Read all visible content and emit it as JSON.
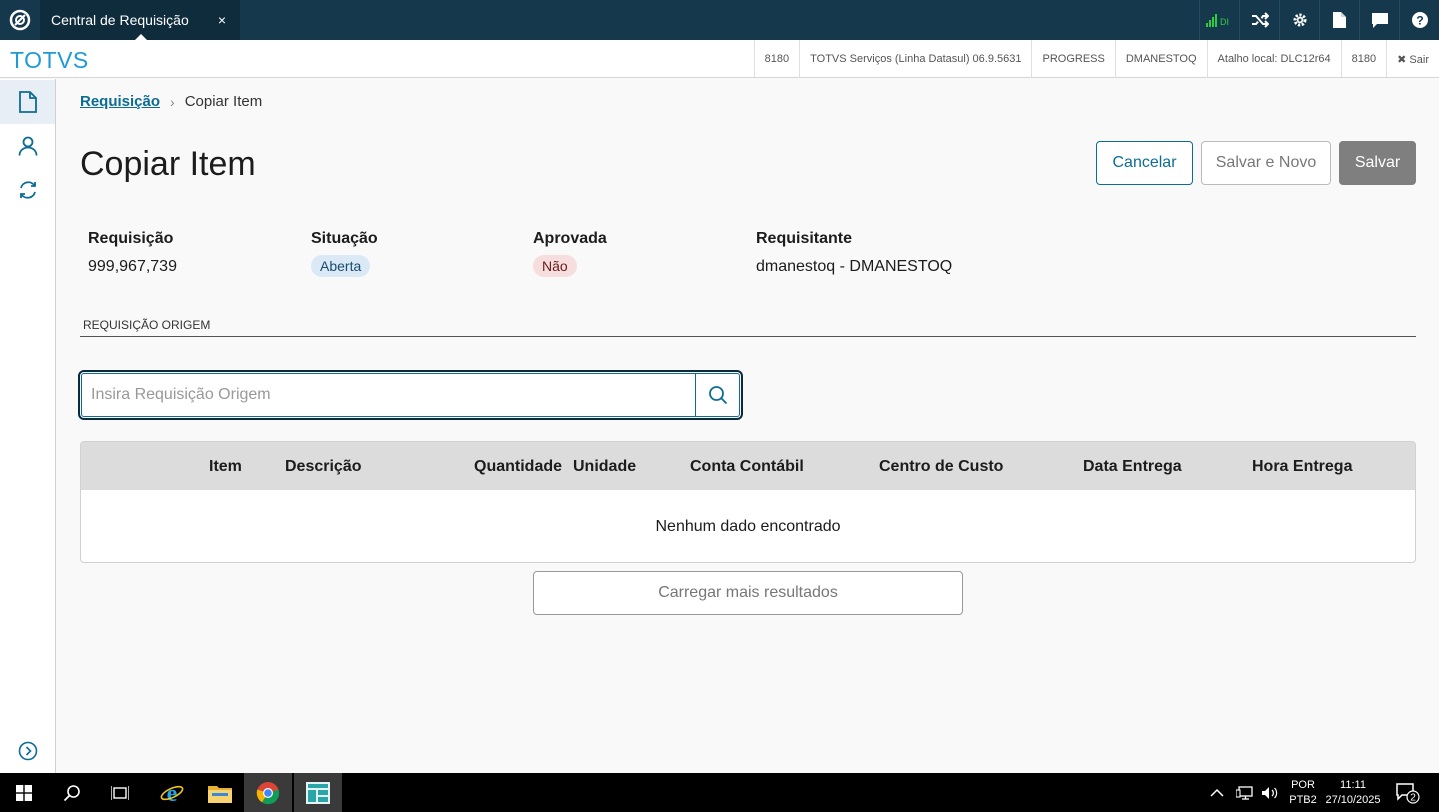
{
  "titlebar": {
    "tab_title": "Central de Requisição",
    "tab_close": "×",
    "signal_label": "DI"
  },
  "infobar": {
    "brand": "TOTVS",
    "items": [
      "8180",
      "TOTVS Serviços (Linha Datasul) 06.9.5631",
      "PROGRESS",
      "DMANESTOQ",
      "Atalho local: DLC12r64",
      "8180"
    ],
    "exit_label": "✖ Sair"
  },
  "breadcrumb": {
    "link": "Requisição",
    "separator": "›",
    "current": "Copiar Item"
  },
  "page": {
    "title": "Copiar Item"
  },
  "actions": {
    "cancel": "Cancelar",
    "save_new": "Salvar e Novo",
    "save": "Salvar"
  },
  "details": {
    "requisicao_label": "Requisição",
    "requisicao_value": "999,967,739",
    "situacao_label": "Situação",
    "situacao_value": "Aberta",
    "aprovada_label": "Aprovada",
    "aprovada_value": "Não",
    "requisitante_label": "Requisitante",
    "requisitante_value": "dmanestoq - DMANESTOQ"
  },
  "section": {
    "title": "REQUISIÇÃO ORIGEM"
  },
  "search": {
    "placeholder": "Insira Requisição Origem",
    "value": ""
  },
  "table": {
    "columns": [
      "Item",
      "Descrição",
      "Quantidade",
      "Unidade",
      "Conta Contábil",
      "Centro de Custo",
      "Data Entrega",
      "Hora Entrega"
    ],
    "empty_message": "Nenhum dado encontrado"
  },
  "load_more": "Carregar mais resultados",
  "taskbar": {
    "lang_top": "POR",
    "lang_bottom": "PTB2",
    "time": "11:11",
    "date": "27/10/2025",
    "notif_count": "2"
  },
  "colors": {
    "topbar": "#16384d",
    "brand": "#1e9bd7",
    "primary": "#0c6c94",
    "save_disabled": "#7f7f7f"
  }
}
